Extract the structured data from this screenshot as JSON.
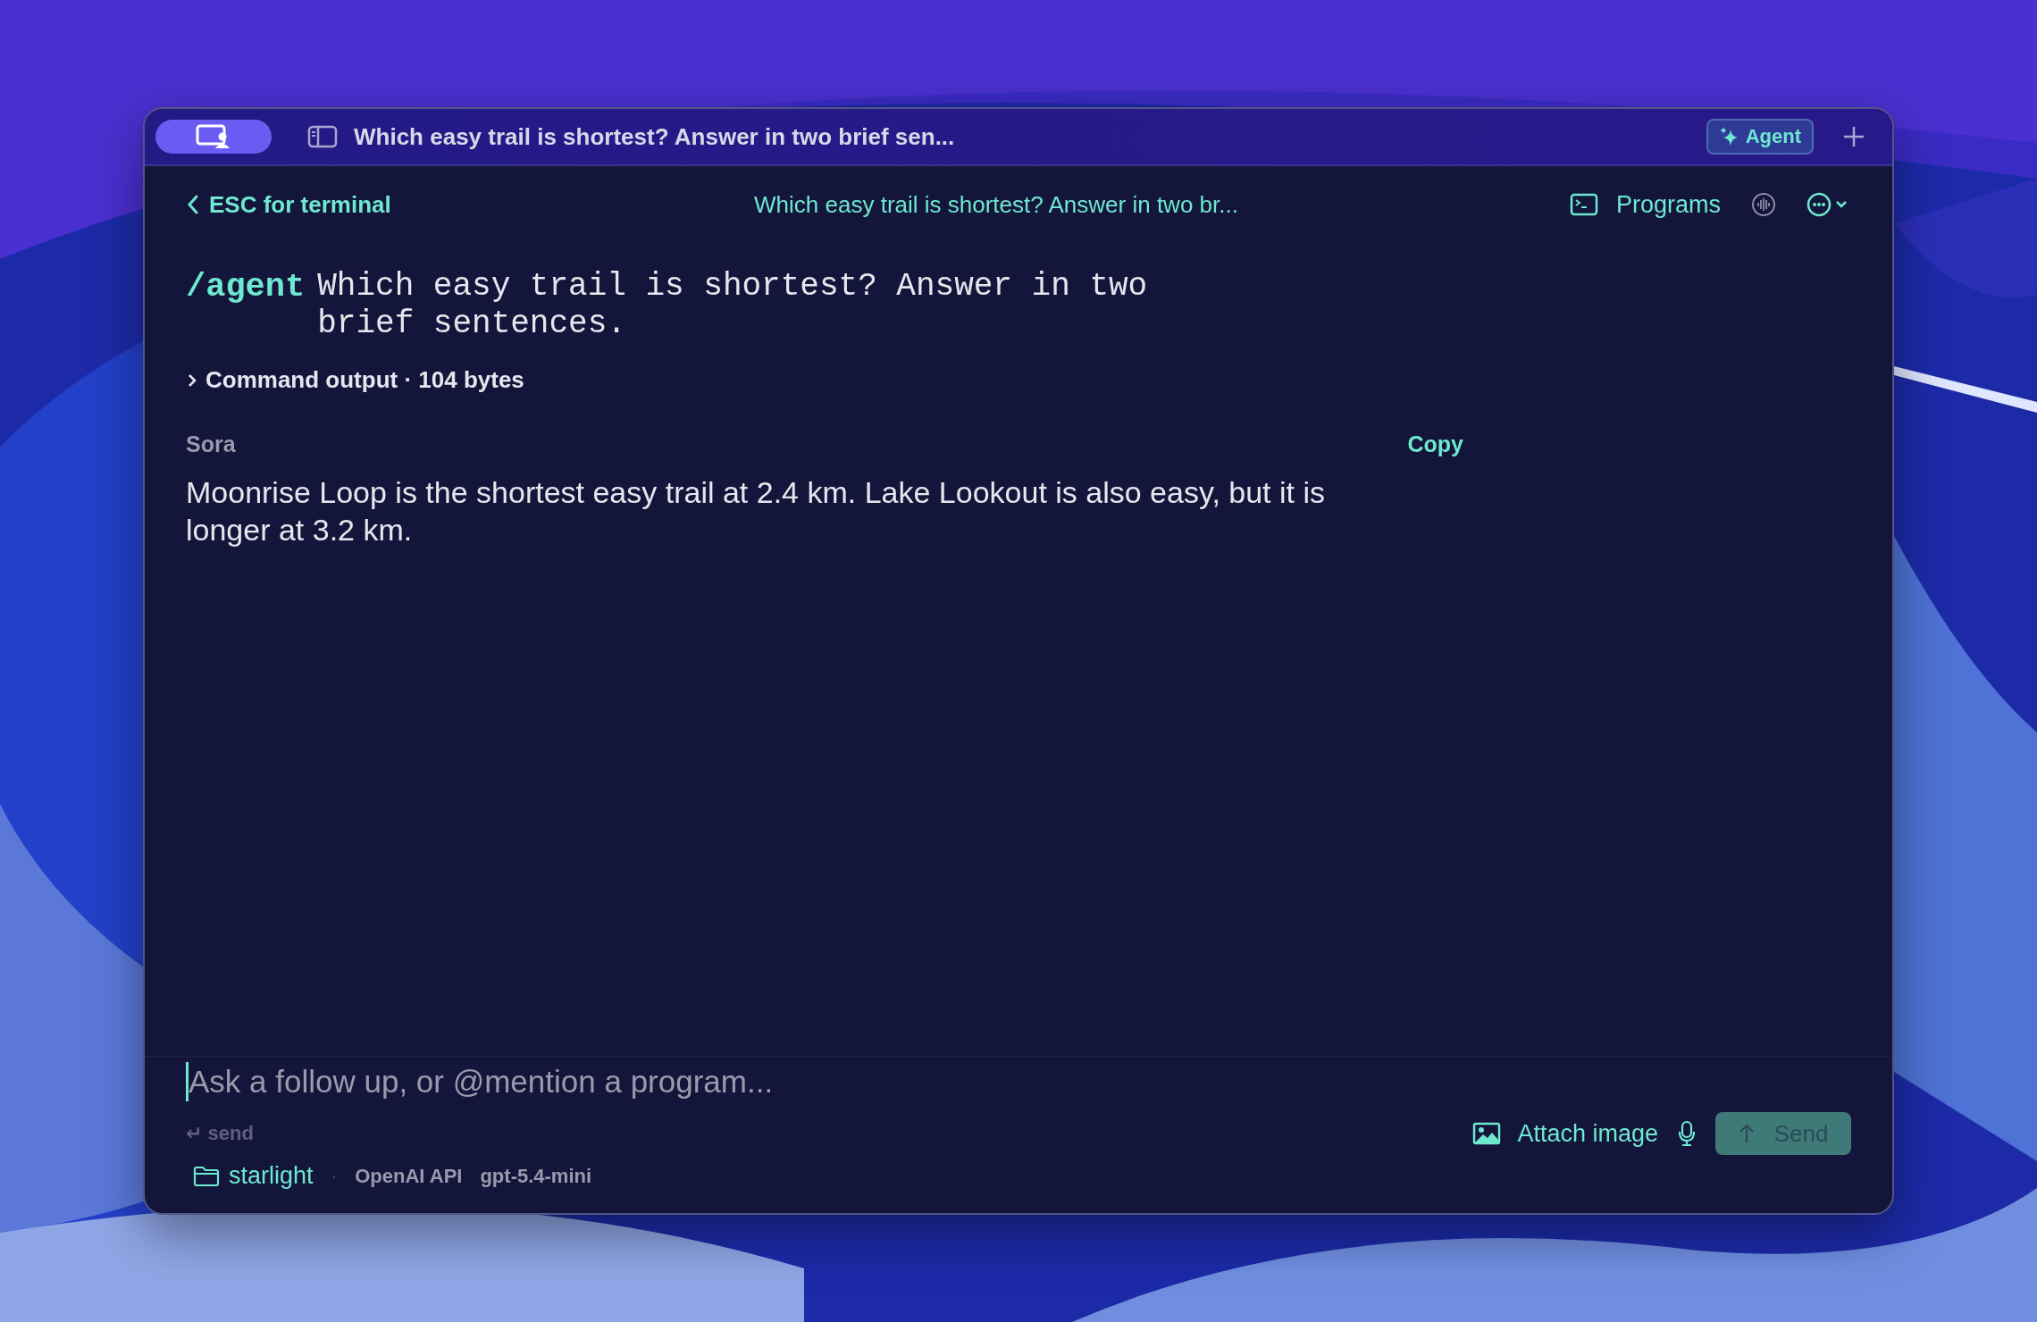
{
  "window": {
    "title": "Which easy trail is shortest? Answer in two brief sen...",
    "agent_button": "Agent"
  },
  "header": {
    "back": "ESC for terminal",
    "title": "Which easy trail is shortest? Answer in two br...",
    "programs": "Programs"
  },
  "prompt": {
    "command": "/agent",
    "text": "Which easy trail is shortest? Answer in two brief sentences."
  },
  "output": {
    "expanded": false,
    "label": "Command output · 104 bytes"
  },
  "message": {
    "author": "Sora",
    "copy": "Copy",
    "text": "Moonrise Loop is the shortest easy trail at 2.4 km. Lake Lookout is also easy, but it is longer at 3.2 km."
  },
  "composer": {
    "placeholder": "Ask a follow up, or @mention a program...",
    "hint": "↵ send",
    "attach": "Attach image",
    "send": "Send"
  },
  "footer": {
    "folder": "starlight",
    "separator": "·",
    "provider": "OpenAI API",
    "model": "gpt-5.4-mini"
  }
}
